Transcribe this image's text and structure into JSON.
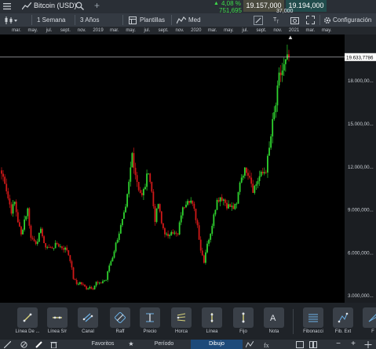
{
  "header": {
    "symbol": "Bitcoin (USD)",
    "add_label": "+",
    "change_pct": "4,08 %",
    "change_abs": "751,695",
    "bid": "19.157,000",
    "ask": "19.194,000",
    "spread": "37,000"
  },
  "toolbar": {
    "timeframe": "1 Semana",
    "period": "3 Años",
    "templates": "Plantillas",
    "indicator": "Med",
    "settings": "Configuración"
  },
  "month_labels": [
    "mar.",
    "may.",
    "jul.",
    "sept.",
    "nov.",
    "2019",
    "mar.",
    "may.",
    "jul.",
    "sept.",
    "nov.",
    "2020",
    "mar.",
    "may.",
    "jul.",
    "sept.",
    "nov.",
    "2021",
    "mar.",
    "may."
  ],
  "price_axis": {
    "current_label": "19.633,7786",
    "labels": [
      "18.000,00...",
      "15.000,00...",
      "12.000,00...",
      "9.000,000...",
      "6.000,000...",
      "3.000,000..."
    ]
  },
  "chart_data": {
    "type": "candlestick",
    "x_range": [
      "2018-01",
      "2021-06"
    ],
    "y_range": [
      2600,
      21100
    ],
    "up_color": "#2fd32f",
    "down_color": "#d01818",
    "current_price": 19633.7786,
    "grid": false,
    "weekly_close_path": [
      11500,
      11000,
      9800,
      8900,
      9500,
      8200,
      7200,
      8300,
      9000,
      7000,
      6900,
      6600,
      7800,
      6500,
      6400,
      6300,
      6400,
      6600,
      6400,
      6300,
      6200,
      5500,
      4200,
      3800,
      3900,
      3700,
      3500,
      3600,
      3500,
      3900,
      3800,
      4000,
      4100,
      5100,
      5700,
      6600,
      7400,
      8200,
      9000,
      10800,
      12900,
      11500,
      10500,
      9900,
      10700,
      11800,
      10200,
      8300,
      9400,
      8000,
      7400,
      7000,
      7600,
      7300,
      7200,
      8700,
      9300,
      9800,
      9600,
      8900,
      7900,
      6200,
      5400,
      6700,
      7200,
      8800,
      9600,
      9900,
      9700,
      9300,
      9200,
      9100,
      9300,
      11000,
      11600,
      11800,
      11400,
      10400,
      10800,
      11300,
      11500,
      11800,
      13200,
      15000,
      16300,
      18200,
      18700,
      19200,
      19634
    ]
  },
  "tools": [
    {
      "label": "Línea De ...",
      "icon": "trendline-icon"
    },
    {
      "label": "Línea S/r",
      "icon": "support-line-icon"
    },
    {
      "label": "Canal",
      "icon": "channel-icon"
    },
    {
      "label": "Raff",
      "icon": "raff-icon"
    },
    {
      "label": "Precio",
      "icon": "price-range-icon"
    },
    {
      "label": "Horca",
      "icon": "pitchfork-icon"
    },
    {
      "label": "Línea",
      "icon": "vertical-line-icon"
    },
    {
      "label": "Fijo",
      "icon": "fixed-icon"
    },
    {
      "label": "Nota",
      "icon": "note-icon"
    },
    {
      "label": "Fibonacci",
      "icon": "fibonacci-icon"
    },
    {
      "label": "Fib. Ext",
      "icon": "fib-ext-icon"
    },
    {
      "label": "F",
      "icon": "fib-fan-icon"
    }
  ],
  "bottom": {
    "favorites": "Favoritos",
    "period": "Período",
    "drawing": "Dibujo",
    "zoom_out": "−",
    "zoom_in": "+"
  }
}
